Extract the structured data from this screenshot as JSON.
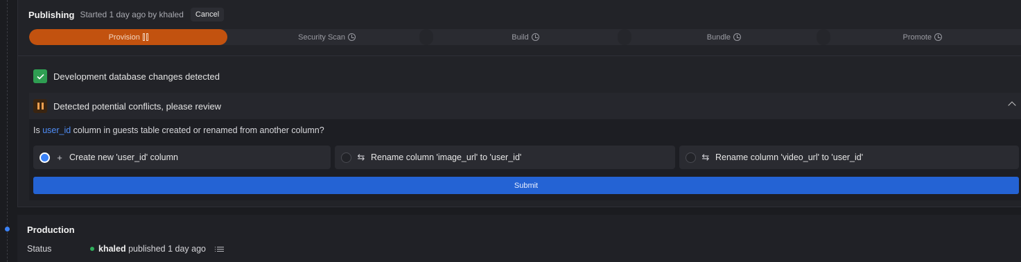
{
  "publishing": {
    "title": "Publishing",
    "meta": "Started 1 day ago by khaled",
    "cancel_label": "Cancel",
    "steps": [
      {
        "label": "Provision",
        "state": "active",
        "icon": "pause-icon"
      },
      {
        "label": "Security Scan",
        "state": "pending",
        "icon": "clock-icon"
      },
      {
        "label": "Build",
        "state": "pending",
        "icon": "clock-icon"
      },
      {
        "label": "Bundle",
        "state": "pending",
        "icon": "clock-icon"
      },
      {
        "label": "Promote",
        "state": "pending",
        "icon": "clock-icon"
      }
    ],
    "db_changes": {
      "label": "Development database changes detected",
      "icon": "check-icon"
    },
    "conflicts": {
      "label": "Detected potential conflicts, please review",
      "icon": "pause-icon",
      "question_prefix": "Is ",
      "question_column": "user_id",
      "question_suffix": " column in guests table created or renamed from another column?",
      "options": [
        {
          "label": "Create new 'user_id' column",
          "icon": "plus-icon",
          "glyph": "+",
          "selected": true
        },
        {
          "label": "Rename column 'image_url' to 'user_id'",
          "icon": "swap-icon",
          "glyph": "⇆",
          "selected": false
        },
        {
          "label": "Rename column 'video_url' to 'user_id'",
          "icon": "swap-icon",
          "glyph": "⇆",
          "selected": false
        }
      ],
      "submit_label": "Submit"
    }
  },
  "production": {
    "title": "Production",
    "status_label": "Status",
    "status_user": "khaled",
    "status_text": " published 1 day ago"
  },
  "colors": {
    "accent": "#2463d4",
    "active_step": "#c2520f",
    "success": "#2f9e52",
    "link": "#4f8df7",
    "status_dot": "#2fae5b"
  }
}
